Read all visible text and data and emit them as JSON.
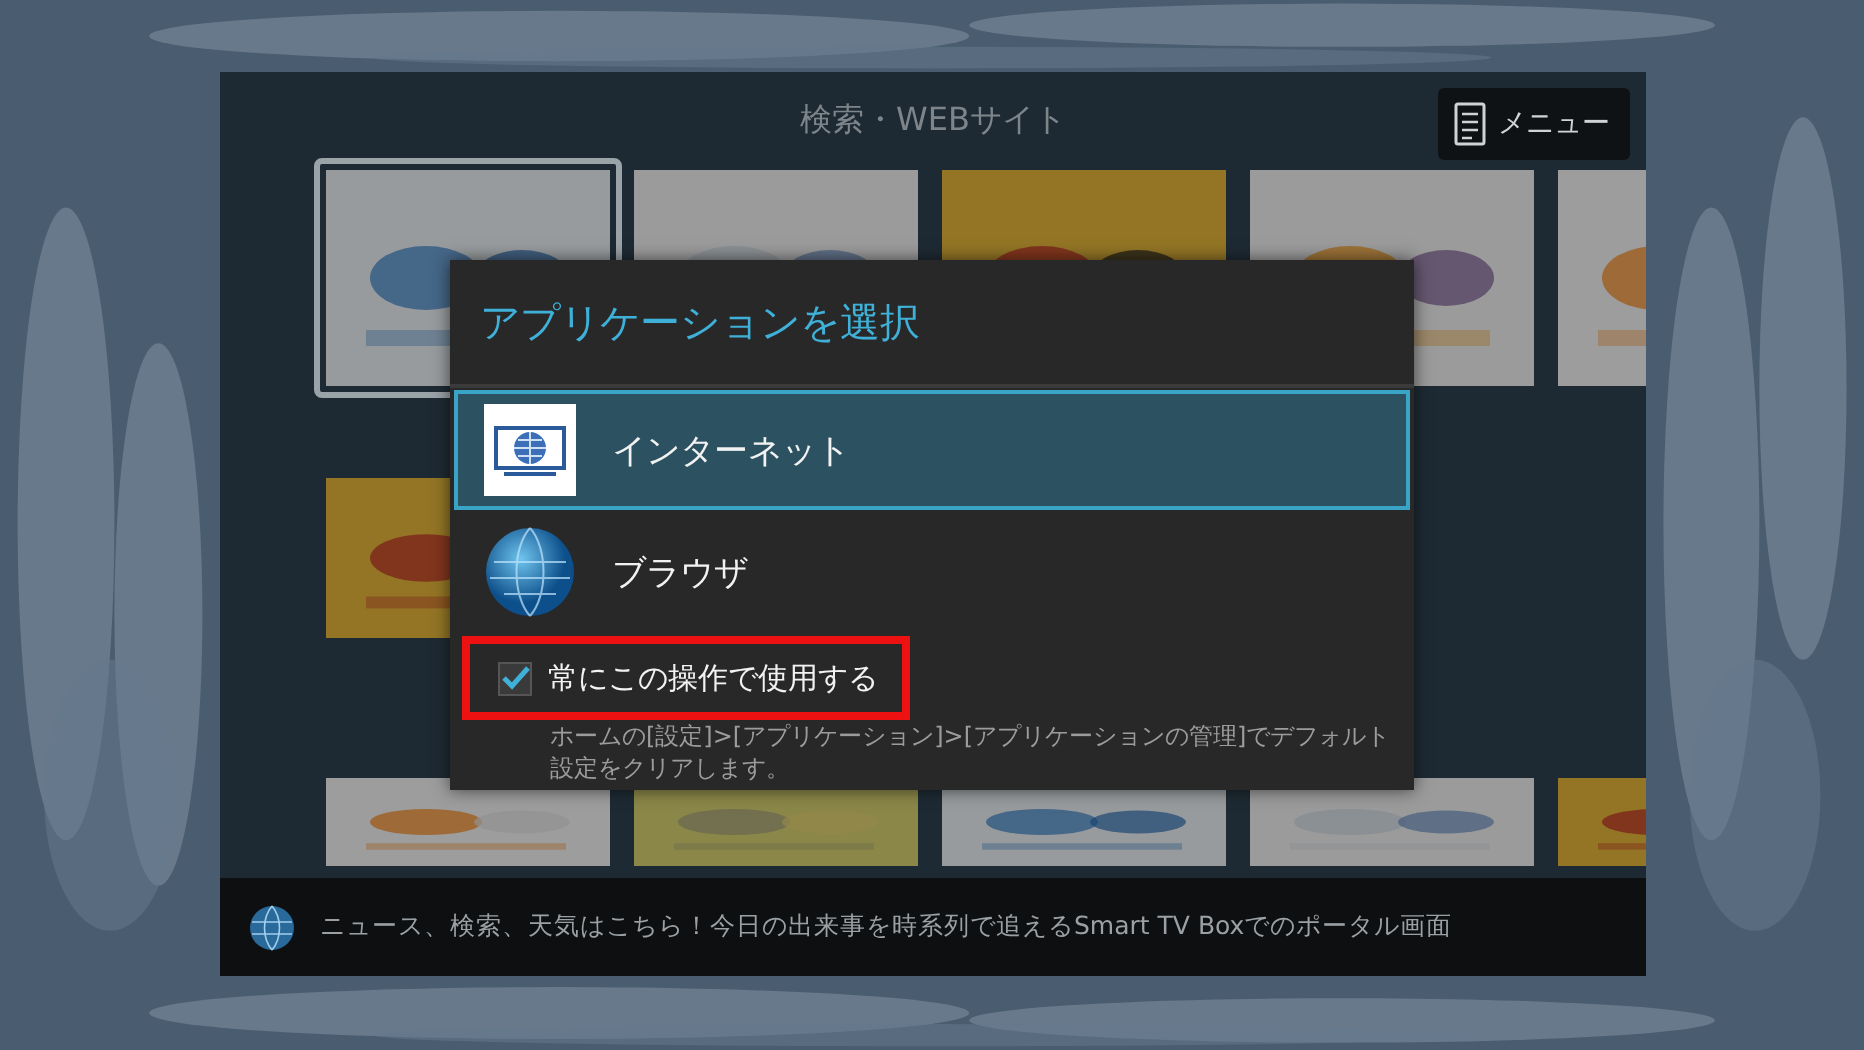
{
  "screen": {
    "title": "検索・WEBサイト",
    "menu_button": "メニュー"
  },
  "tile_rows": [
    [
      {
        "selected": true
      },
      {
        "selected": false
      },
      {
        "selected": false
      },
      {
        "selected": false
      },
      {
        "selected": false
      }
    ],
    [
      {
        "selected": false
      }
    ],
    [
      {
        "selected": false
      },
      {
        "selected": false
      },
      {
        "selected": false
      },
      {
        "selected": false
      },
      {
        "selected": false
      }
    ]
  ],
  "dialog": {
    "title": "アプリケーションを選択",
    "apps": [
      {
        "name": "インターネット",
        "kind": "tv",
        "selected": true
      },
      {
        "name": "ブラウザ",
        "kind": "globe",
        "selected": false
      }
    ],
    "always_use": {
      "label": "常にこの操作で使用する",
      "checked": true,
      "highlighted": true
    },
    "note": "ホームの[設定]>[アプリケーション]>[アプリケーションの管理]でデフォルト設定をクリアします。"
  },
  "footer": {
    "text": "ニュース、検索、天気はこちら！今日の出来事を時系列で追えるSmart TV Boxでのポータル画面"
  }
}
